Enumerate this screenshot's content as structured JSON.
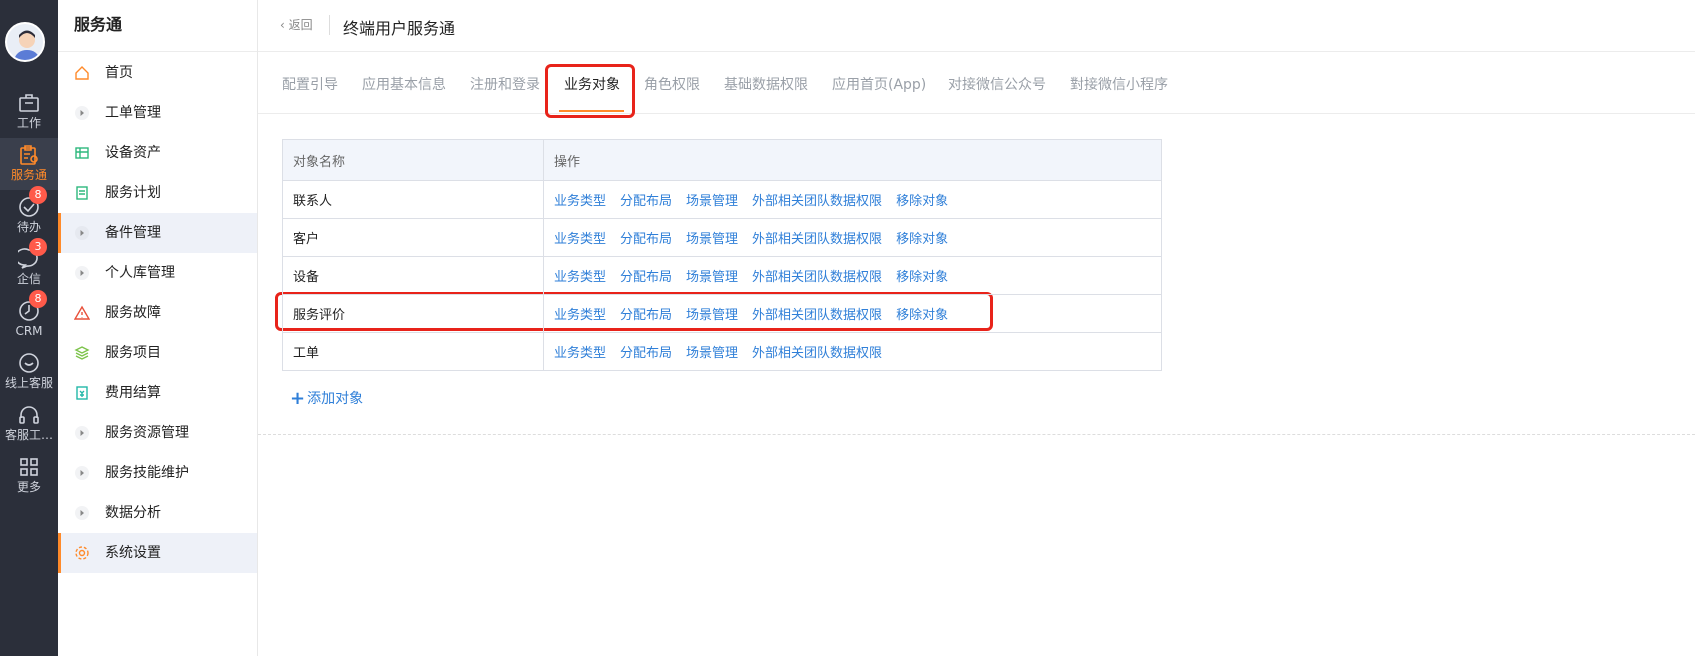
{
  "rail": {
    "items": [
      {
        "label": "工作",
        "icon": "briefcase-icon"
      },
      {
        "label": "服务通",
        "icon": "service-icon",
        "active": true
      },
      {
        "label": "待办",
        "icon": "check-circle-icon",
        "badge": "8"
      },
      {
        "label": "企信",
        "icon": "chat-icon",
        "badge": "3"
      },
      {
        "label": "CRM",
        "icon": "clock-icon",
        "badge": "8"
      },
      {
        "label": "线上客服",
        "icon": "smile-chat-icon"
      },
      {
        "label": "客服工…",
        "icon": "headset-icon"
      },
      {
        "label": "更多",
        "icon": "grid-icon"
      }
    ]
  },
  "sidebar": {
    "title": "服务通",
    "items": [
      {
        "label": "首页",
        "icon": "home-icon"
      },
      {
        "label": "工单管理",
        "icon": "caret-right-icon"
      },
      {
        "label": "设备资产",
        "icon": "device-icon"
      },
      {
        "label": "服务计划",
        "icon": "document-icon"
      },
      {
        "label": "备件管理",
        "icon": "caret-right-icon"
      },
      {
        "label": "个人库管理",
        "icon": "caret-right-icon"
      },
      {
        "label": "服务故障",
        "icon": "warning-icon"
      },
      {
        "label": "服务项目",
        "icon": "layers-icon"
      },
      {
        "label": "费用结算",
        "icon": "bill-icon"
      },
      {
        "label": "服务资源管理",
        "icon": "caret-right-icon"
      },
      {
        "label": "服务技能维护",
        "icon": "caret-right-icon"
      },
      {
        "label": "数据分析",
        "icon": "caret-right-icon"
      },
      {
        "label": "系统设置",
        "icon": "gear-icon"
      }
    ]
  },
  "header": {
    "back_label": "返回",
    "title": "终端用户服务通"
  },
  "tabs": [
    "配置引导",
    "应用基本信息",
    "注册和登录",
    "业务对象",
    "角色权限",
    "基础数据权限",
    "应用首页(App)",
    "对接微信公众号",
    "對接微信小程序"
  ],
  "table": {
    "headers": [
      "对象名称",
      "操作"
    ],
    "rows": [
      {
        "name": "联系人",
        "ops": [
          "业务类型",
          "分配布局",
          "场景管理",
          "外部相关团队数据权限",
          "移除对象"
        ]
      },
      {
        "name": "客户",
        "ops": [
          "业务类型",
          "分配布局",
          "场景管理",
          "外部相关团队数据权限",
          "移除对象"
        ]
      },
      {
        "name": "设备",
        "ops": [
          "业务类型",
          "分配布局",
          "场景管理",
          "外部相关团队数据权限",
          "移除对象"
        ]
      },
      {
        "name": "服务评价",
        "ops": [
          "业务类型",
          "分配布局",
          "场景管理",
          "外部相关团队数据权限",
          "移除对象"
        ]
      },
      {
        "name": "工单",
        "ops": [
          "业务类型",
          "分配布局",
          "场景管理",
          "外部相关团队数据权限"
        ]
      }
    ]
  },
  "add_object_label": "添加对象",
  "colors": {
    "accent": "#ff8a2a",
    "link": "#2f7fd8",
    "highlight": "#e8231a",
    "rail_bg": "#2b2f3a"
  }
}
